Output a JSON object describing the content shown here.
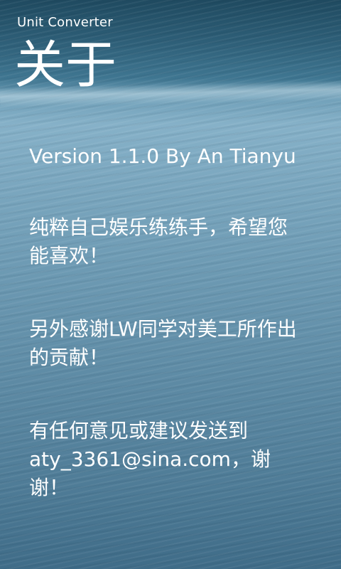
{
  "header": {
    "app_title": "Unit Converter",
    "page_title": "关于"
  },
  "content": {
    "version": "Version 1.1.0 By An Tianyu",
    "para1": "纯粹自己娱乐练练手，希望您能喜欢！",
    "para2": "另外感谢LW同学对美工所作出的贡献！",
    "para3": "有任何意见或建议发送到aty_3361@sina.com，谢谢！"
  }
}
